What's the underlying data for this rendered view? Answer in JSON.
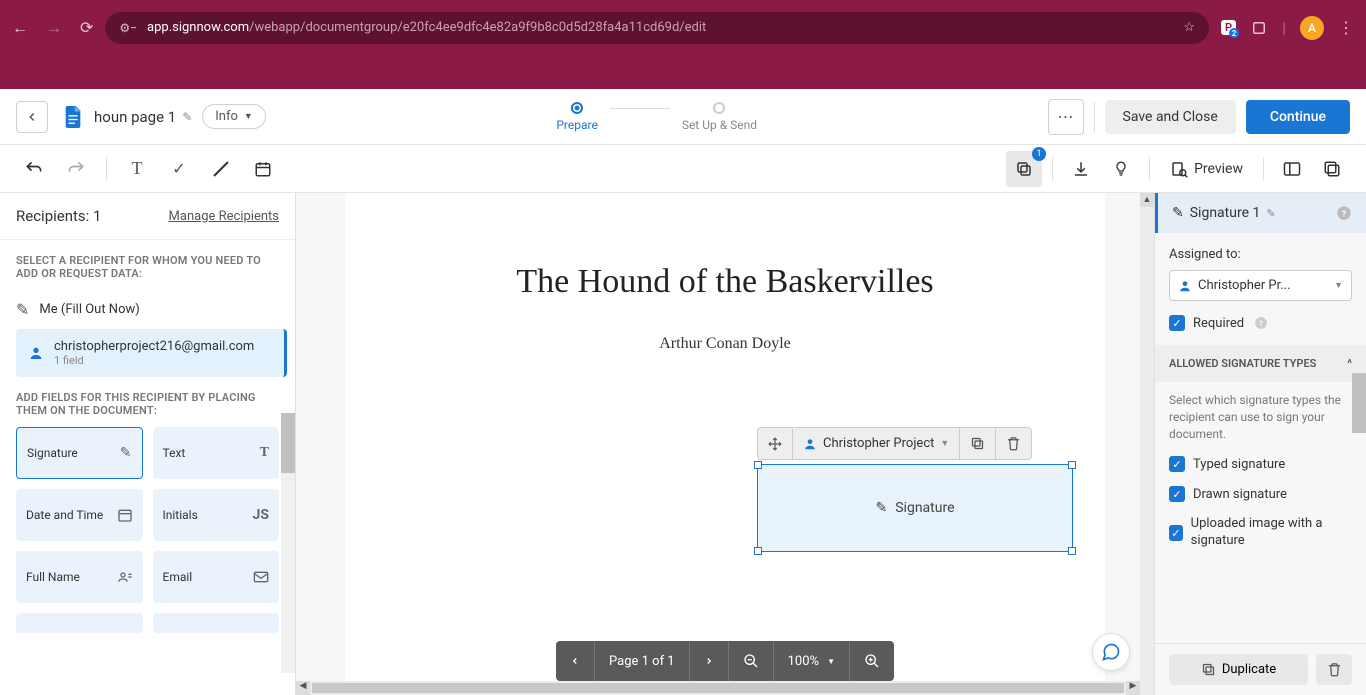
{
  "browser": {
    "url_domain": "app.signnow.com",
    "url_path": "/webapp/documentgroup/e20fc4ee9dfc4e82a9f9b8c0d5d28fa4a11cd69d/edit",
    "avatar_letter": "A",
    "ext_badge": "P"
  },
  "header": {
    "doc_title": "houn page 1",
    "info_label": "Info",
    "step1": "Prepare",
    "step2": "Set Up & Send",
    "save_label": "Save and Close",
    "continue_label": "Continue",
    "preview_label": "Preview",
    "copy_badge": "1"
  },
  "left": {
    "recipients_title": "Recipients: 1",
    "manage_label": "Manage Recipients",
    "select_hint": "SELECT A RECIPIENT FOR WHOM YOU NEED TO ADD OR REQUEST DATA:",
    "me_label": "Me (Fill Out Now)",
    "recipient_email": "christopherproject216@gmail.com",
    "recipient_sub": "1 field",
    "add_fields_hint": "ADD FIELDS FOR THIS RECIPIENT BY PLACING THEM ON THE DOCUMENT:",
    "fields": {
      "signature": "Signature",
      "text": "Text",
      "datetime": "Date and Time",
      "initials": "Initials",
      "fullname": "Full Name",
      "email": "Email"
    }
  },
  "doc": {
    "title": "The Hound of the Baskervilles",
    "author": "Arthur Conan Doyle",
    "field_owner": "Christopher Project",
    "field_label": "Signature"
  },
  "pagenav": {
    "page_text": "Page 1 of 1",
    "zoom_text": "100%"
  },
  "right": {
    "title": "Signature 1",
    "assigned_label": "Assigned to:",
    "assigned_value": "Christopher Pr...",
    "required_label": "Required",
    "types_header": "ALLOWED SIGNATURE TYPES",
    "types_desc": "Select which signature types the recipient can use to sign your document.",
    "type_typed": "Typed signature",
    "type_drawn": "Drawn signature",
    "type_uploaded": "Uploaded image with a signature",
    "duplicate_label": "Duplicate"
  }
}
